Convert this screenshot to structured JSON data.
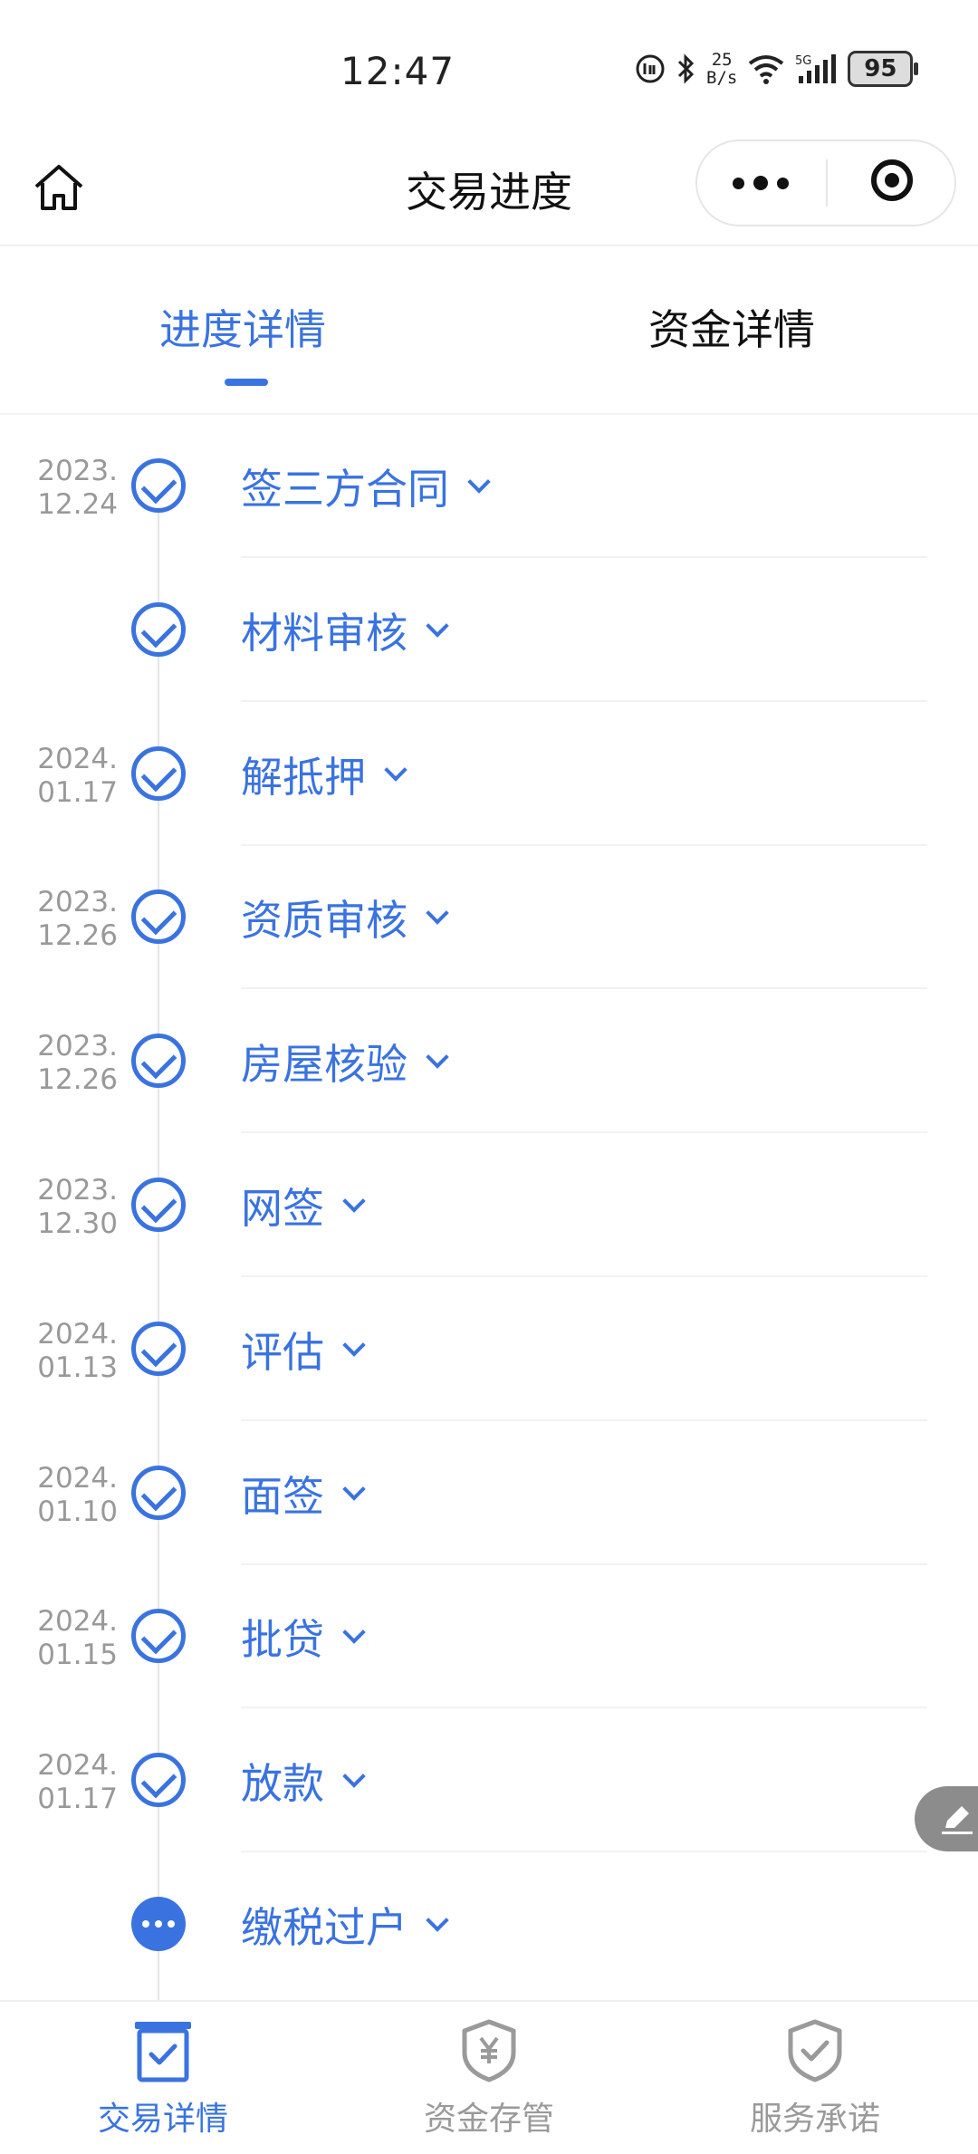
{
  "status_bar": {
    "time": "12:47",
    "net_speed_top": "25",
    "net_speed_bottom": "B/s",
    "network": "5G",
    "battery": "95"
  },
  "nav": {
    "title": "交易进度"
  },
  "tabs": [
    {
      "label": "进度详情",
      "active": true
    },
    {
      "label": "资金详情",
      "active": false
    }
  ],
  "steps": [
    {
      "date_year": "2023.",
      "date_day": "12.24",
      "label": "签三方合同",
      "status": "done"
    },
    {
      "date_year": "",
      "date_day": "",
      "label": "材料审核",
      "status": "done"
    },
    {
      "date_year": "2024.",
      "date_day": "01.17",
      "label": "解抵押",
      "status": "done"
    },
    {
      "date_year": "2023.",
      "date_day": "12.26",
      "label": "资质审核",
      "status": "done"
    },
    {
      "date_year": "2023.",
      "date_day": "12.26",
      "label": "房屋核验",
      "status": "done"
    },
    {
      "date_year": "2023.",
      "date_day": "12.30",
      "label": "网签",
      "status": "done"
    },
    {
      "date_year": "2024.",
      "date_day": "01.13",
      "label": "评估",
      "status": "done"
    },
    {
      "date_year": "2024.",
      "date_day": "01.10",
      "label": "面签",
      "status": "done"
    },
    {
      "date_year": "2024.",
      "date_day": "01.15",
      "label": "批贷",
      "status": "done"
    },
    {
      "date_year": "2024.",
      "date_day": "01.17",
      "label": "放款",
      "status": "done"
    },
    {
      "date_year": "",
      "date_day": "",
      "label": "缴税过户",
      "status": "pending"
    }
  ],
  "bottom_tabs": [
    {
      "label": "交易详情",
      "icon": "document-check-icon",
      "active": true
    },
    {
      "label": "资金存管",
      "icon": "shield-yuan-icon",
      "active": false
    },
    {
      "label": "服务承诺",
      "icon": "shield-check-icon",
      "active": false
    }
  ],
  "colors": {
    "accent": "#3a73e0",
    "muted": "#999999"
  }
}
